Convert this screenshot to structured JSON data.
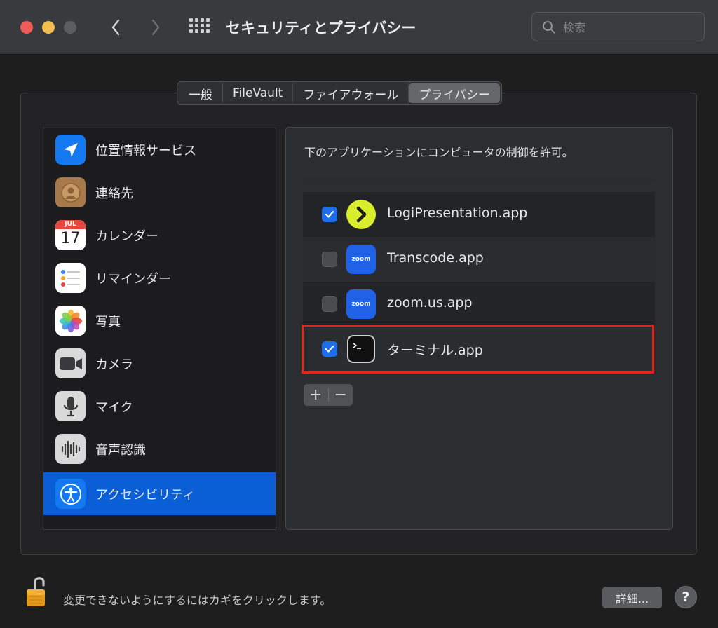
{
  "window": {
    "title": "セキュリティとプライバシー",
    "search_placeholder": "検索"
  },
  "tabs": [
    {
      "label": "一般",
      "active": false
    },
    {
      "label": "FileVault",
      "active": false
    },
    {
      "label": "ファイアウォール",
      "active": false
    },
    {
      "label": "プライバシー",
      "active": true
    }
  ],
  "sidebar": {
    "items": [
      {
        "label": "位置情報サービス",
        "icon": "location-arrow-icon",
        "selected": false
      },
      {
        "label": "連絡先",
        "icon": "contacts-icon",
        "selected": false
      },
      {
        "label": "カレンダー",
        "icon": "calendar-icon",
        "selected": false,
        "icon_month": "JUL",
        "icon_day": "17"
      },
      {
        "label": "リマインダー",
        "icon": "reminders-icon",
        "selected": false
      },
      {
        "label": "写真",
        "icon": "photos-icon",
        "selected": false
      },
      {
        "label": "カメラ",
        "icon": "camera-icon",
        "selected": false
      },
      {
        "label": "マイク",
        "icon": "microphone-icon",
        "selected": false
      },
      {
        "label": "音声認識",
        "icon": "speech-recognition-icon",
        "selected": false
      },
      {
        "label": "アクセシビリティ",
        "icon": "accessibility-icon",
        "selected": true
      }
    ]
  },
  "panel": {
    "description": "下のアプリケーションにコンピュータの制御を許可。",
    "apps": [
      {
        "name": "LogiPresentation.app",
        "checked": true,
        "icon": "logi-presentation-icon"
      },
      {
        "name": "Transcode.app",
        "checked": false,
        "icon": "zoom-icon",
        "icon_text": "zoom"
      },
      {
        "name": "zoom.us.app",
        "checked": false,
        "icon": "zoom-icon",
        "icon_text": "zoom"
      },
      {
        "name": "ターミナル.app",
        "checked": true,
        "icon": "terminal-icon"
      }
    ],
    "add_label": "+",
    "remove_label": "−"
  },
  "footer": {
    "lock_text": "変更できないようにするにはカギをクリックします。",
    "advanced_label": "詳細...",
    "help_label": "?"
  },
  "colors": {
    "accent": "#0a5fd6",
    "checkbox_on": "#1d6ee8",
    "highlight": "#e0271a"
  }
}
